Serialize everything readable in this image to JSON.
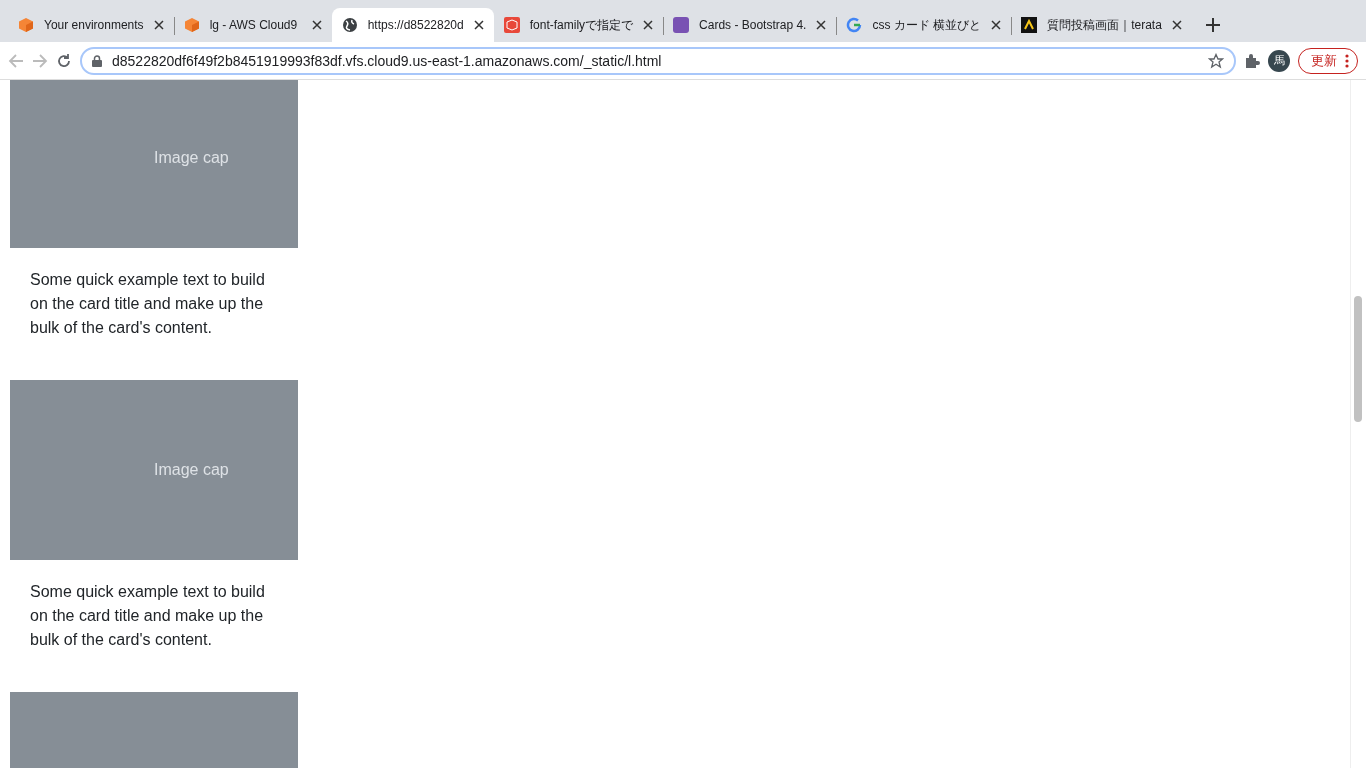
{
  "tabs": [
    {
      "title": "Your environments",
      "selected": false
    },
    {
      "title": "lg - AWS Cloud9",
      "selected": false
    },
    {
      "title": "https://d8522820d",
      "selected": true
    },
    {
      "title": "font-familyで指定で",
      "selected": false
    },
    {
      "title": "Cards - Bootstrap 4.",
      "selected": false
    },
    {
      "title": "css カード 横並びと",
      "selected": false
    },
    {
      "title": "質問投稿画面｜terata",
      "selected": false
    }
  ],
  "address": "d8522820df6f49f2b8451919993f83df.vfs.cloud9.us-east-1.amazonaws.com/_static/l.html",
  "profile": "馬",
  "update_button": "更新",
  "cards": [
    {
      "kind": "card",
      "caption": "Image cap",
      "text": "Some quick example text to build on the card title and make up the bulk of the card's content."
    },
    {
      "kind": "card",
      "caption": "Image cap",
      "text": "Some quick example text to build on the card title and make up the bulk of the card's content."
    },
    {
      "kind": "cut"
    }
  ]
}
